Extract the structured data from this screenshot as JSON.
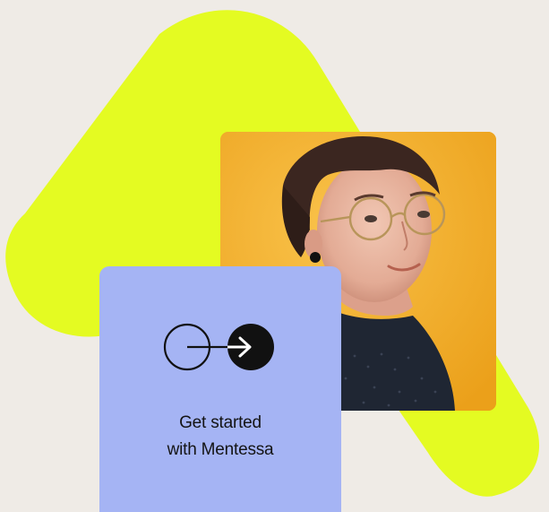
{
  "cta": {
    "line1": "Get started",
    "line2": "with Mentessa",
    "icon": "arrow-into-circle-icon"
  },
  "photo": {
    "subject": "person-with-round-glasses"
  },
  "colors": {
    "background": "#efebe6",
    "accent_shape": "#e4fb22",
    "card": "#a5b4f4",
    "photo_bg": "#f2a91d",
    "text": "#141414"
  }
}
